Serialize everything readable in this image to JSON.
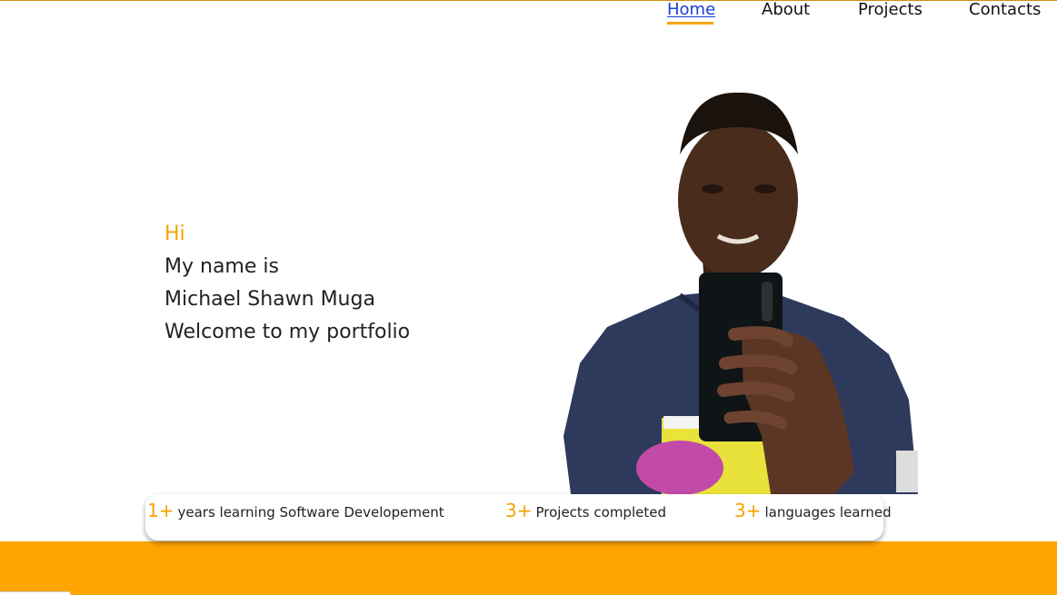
{
  "nav": {
    "items": [
      {
        "label": "Home",
        "active": true
      },
      {
        "label": "About",
        "active": false
      },
      {
        "label": "Projects",
        "active": false
      },
      {
        "label": "Contacts",
        "active": false
      }
    ]
  },
  "hero": {
    "greeting": "Hi",
    "line1": "My name is",
    "name": "Michael Shawn Muga",
    "line3": "Welcome to my portfolio"
  },
  "stats": [
    {
      "number": "1+",
      "text": "years learning Software Developement"
    },
    {
      "number": "3+",
      "text": "Projects completed"
    },
    {
      "number": "3+",
      "text": "languages learned"
    }
  ],
  "colors": {
    "accent": "#ffa500",
    "link_active": "#1a3fd6"
  }
}
